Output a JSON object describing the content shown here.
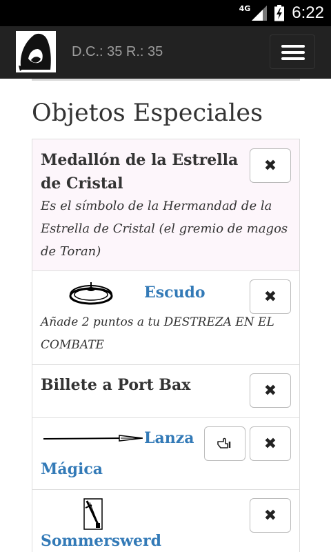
{
  "statusbar": {
    "network": "4G",
    "time": "6:22",
    "icons": [
      "signal-icon",
      "battery-charging-icon"
    ]
  },
  "navbar": {
    "logo_icon": "hooded-figure-logo",
    "stats_text": "D.C.: 35 R.: 35",
    "menu_icon": "hamburger-menu-icon"
  },
  "page": {
    "title": "Objetos Especiales"
  },
  "items": [
    {
      "name": "Medallón de la Estrella de Cristal",
      "description": "Es el símbolo de la Hermandad de la Estrella de Cristal (el gremio de magos de Toran)",
      "drop_label": "✖"
    },
    {
      "name": "Escudo",
      "description": "Añade 2 puntos a tu DESTREZA EN EL COMBATE",
      "image_icon": "shield-icon",
      "drop_label": "✖"
    },
    {
      "name": "Billete a Port Bax",
      "drop_label": "✖"
    },
    {
      "name_part1": "Lanza",
      "name_part2": "Mágica",
      "image_icon": "spear-icon",
      "use_icon": "hand-pointing-icon",
      "drop_label": "✖"
    },
    {
      "name": "Sommerswerd",
      "image_icon": "sword-icon",
      "drop_label": "✖"
    }
  ],
  "colors": {
    "navbar_bg": "#222222",
    "link": "#337ab7",
    "text": "#333333",
    "highlight_bg": "#fdf6fb"
  }
}
